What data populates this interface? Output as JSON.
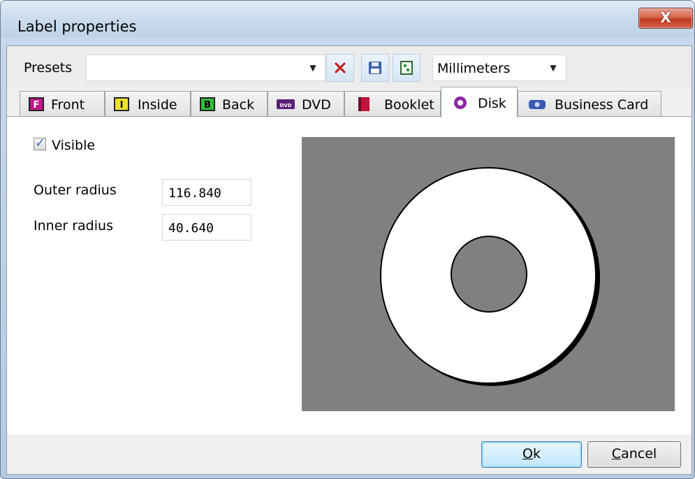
{
  "window": {
    "title": "Label properties",
    "close_glyph": "X"
  },
  "presets": {
    "label": "Presets",
    "value": "",
    "units": "Millimeters",
    "toolbar_icons": [
      "delete-icon",
      "save-icon",
      "layout-icon"
    ]
  },
  "tabs": [
    {
      "label": "Front",
      "icon": "front-icon",
      "color": "#c2188c"
    },
    {
      "label": "Inside",
      "icon": "inside-icon",
      "color": "#f0e12a"
    },
    {
      "label": "Back",
      "icon": "back-icon",
      "color": "#2fbf3a"
    },
    {
      "label": "DVD",
      "icon": "dvd-icon",
      "color": "#5b1f78"
    },
    {
      "label": "Booklet",
      "icon": "booklet-icon",
      "color": "#c0143a"
    },
    {
      "label": "Disk",
      "icon": "disk-icon",
      "color": "#8a2aa0",
      "active": true
    },
    {
      "label": "Business Card",
      "icon": "business-card-icon",
      "color": "#3a5bb5"
    }
  ],
  "disk": {
    "visible_label": "Visible",
    "visible_checked": true,
    "outer_radius_label": "Outer radius",
    "outer_radius_value": "116.840",
    "inner_radius_label": "Inner radius",
    "inner_radius_value": "40.640"
  },
  "buttons": {
    "ok_mnemonic": "O",
    "ok_rest": "k",
    "cancel_mnemonic": "C",
    "cancel_rest": "ancel"
  },
  "colors": {
    "preview_background": "#808080",
    "disk_fill": "#ffffff"
  }
}
